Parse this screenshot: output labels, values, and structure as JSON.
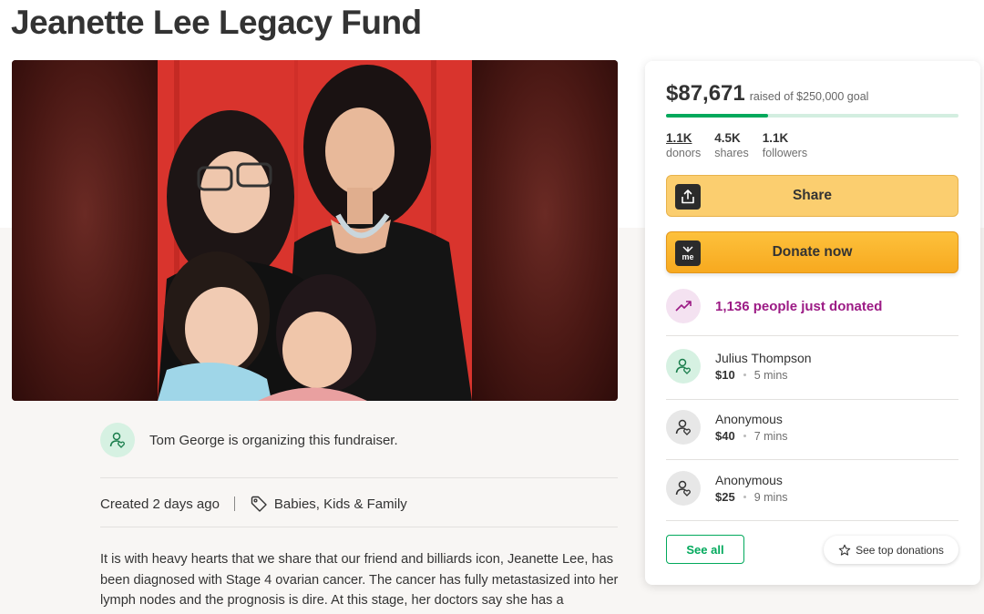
{
  "page": {
    "title": "Jeanette Lee Legacy Fund"
  },
  "organizer": {
    "text": "Tom George is organizing this fundraiser."
  },
  "meta": {
    "created": "Created 2 days ago",
    "category": "Babies, Kids & Family"
  },
  "story": {
    "text": "It is with heavy hearts that we share that our friend and billiards icon, Jeanette Lee, has been diagnosed with Stage 4 ovarian cancer.  The cancer has fully metastasized into her lymph nodes and the prognosis is dire. At this stage, her doctors say she has a"
  },
  "donation_card": {
    "raised": "$87,671",
    "goal_text": "raised of $250,000 goal",
    "progress_fraction": 0.35,
    "stats": [
      {
        "value": "1.1K",
        "label": "donors"
      },
      {
        "value": "4.5K",
        "label": "shares"
      },
      {
        "value": "1.1K",
        "label": "followers"
      }
    ],
    "share_label": "Share",
    "donate_label": "Donate now",
    "donate_icon_text": "me",
    "trend_text": "1,136 people just donated",
    "donors": [
      {
        "name": "Julius Thompson",
        "amount": "$10",
        "time": "5 mins"
      },
      {
        "name": "Anonymous",
        "amount": "$40",
        "time": "7 mins"
      },
      {
        "name": "Anonymous",
        "amount": "$25",
        "time": "9 mins"
      }
    ],
    "see_all_label": "See all",
    "see_top_label": "See top donations"
  },
  "colors": {
    "brand_green": "#02a95c",
    "donate_orange": "#f7a91f",
    "trend_purple": "#9c1b85"
  }
}
